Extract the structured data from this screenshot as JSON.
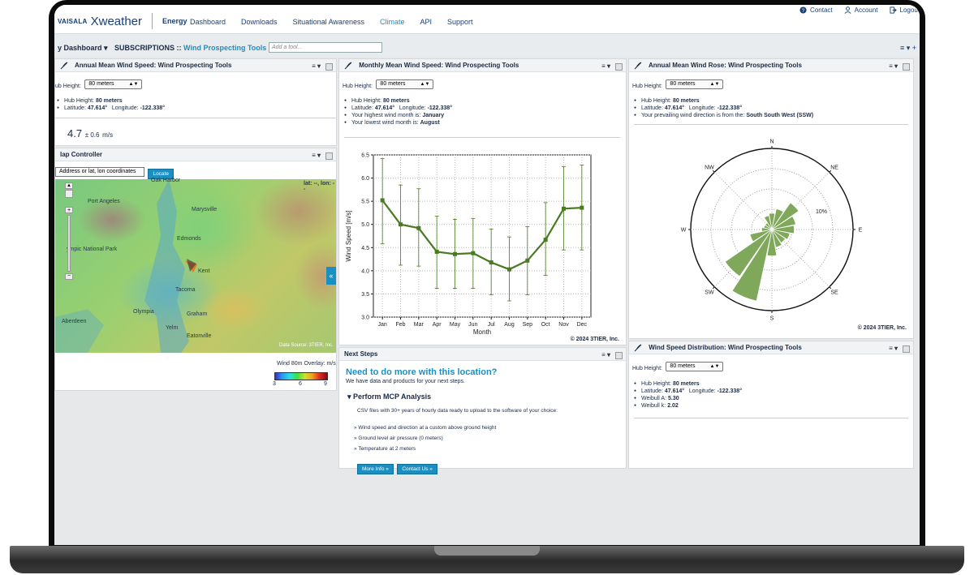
{
  "header": {
    "brand_small": "VAISALA",
    "brand_main": "Xweather",
    "product": "Energy",
    "nav": [
      "Dashboard",
      "Downloads",
      "Situational Awareness",
      "Climate",
      "API",
      "Support"
    ],
    "nav_active": "Climate",
    "util": {
      "contact": "Contact",
      "account": "Account",
      "logout": "Logout"
    }
  },
  "tabbar": {
    "dashboard": "y Dashboard ▾",
    "subs_prefix": "SUBSCRIPTIONS ::",
    "subs_name": "Wind Prospecting Tools",
    "addtool_placeholder": "Add a tool...",
    "rtools": "≡ ▾  +"
  },
  "panel_annual": {
    "title": "Annual Mean Wind Speed: Wind Prospecting Tools",
    "hub_label": "ub Height:",
    "hub_value": "80 meters",
    "info": [
      {
        "k": "Hub Height:",
        "v": "80 meters"
      },
      {
        "k": "Latitude:",
        "v": "47.614°",
        "k2": "Longitude:",
        "v2": "-122.338°"
      }
    ],
    "value": "4.7",
    "pm": "± 0.6",
    "unit": "m/s"
  },
  "panel_map": {
    "title": "lap Controller",
    "input_placeholder": "Address or lat, lon coordinates",
    "locate": "Locate",
    "coords": "lat: --, lon: --",
    "labels": [
      "Oak Harbor",
      "Port Angeles",
      "Marysville",
      "Edmonds",
      "ympic National Park",
      "Kent",
      "Tacoma",
      "Olympia",
      "Graham",
      "Aberdeen",
      "Yelm",
      "Eatonville"
    ],
    "datasource": "Data Source: 3TIER, Inc.",
    "overlay": "Wind 80m Overlay: m/s",
    "scale": [
      "3",
      "6",
      "9"
    ]
  },
  "panel_monthly": {
    "title": "Monthly Mean Wind Speed: Wind Prospecting Tools",
    "hub_label": "Hub Height:",
    "hub_value": "80 meters",
    "info": [
      {
        "k": "Hub Height:",
        "v": "80 meters"
      },
      {
        "k": "Latitude:",
        "v": "47.614°",
        "k2": "Longitude:",
        "v2": "-122.338°"
      },
      {
        "k": "Your highest wind month is:",
        "v": "January"
      },
      {
        "k": "Your lowest wind month is:",
        "v": "August"
      }
    ],
    "copyright": "© 2024 3TIER, Inc."
  },
  "chart_data": {
    "type": "line",
    "categories": [
      "Jan",
      "Feb",
      "Mar",
      "Apr",
      "May",
      "Jun",
      "Jul",
      "Aug",
      "Sep",
      "Oct",
      "Nov",
      "Dec"
    ],
    "values": [
      5.52,
      5.0,
      4.92,
      4.41,
      4.36,
      4.38,
      4.18,
      4.03,
      4.22,
      4.67,
      5.34,
      5.36
    ],
    "error_low": [
      4.58,
      4.12,
      4.1,
      3.62,
      3.62,
      3.62,
      3.48,
      3.35,
      3.48,
      3.9,
      4.45,
      4.45
    ],
    "error_high": [
      6.42,
      5.85,
      5.77,
      5.18,
      5.11,
      5.13,
      4.9,
      4.73,
      4.95,
      5.47,
      6.25,
      6.28
    ],
    "xlabel": "Month",
    "ylabel": "Wind Speed [m/s]",
    "ylim": [
      3.0,
      6.5
    ],
    "yticks": [
      "3.0",
      "3.5",
      "4.0",
      "4.5",
      "5.0",
      "5.5",
      "6.0",
      "6.5"
    ],
    "grid": true,
    "color": "#4a7a22"
  },
  "panel_rose": {
    "title": "Annual Mean Wind Rose: Wind Prospecting Tools",
    "hub_label": "Hub Height:",
    "hub_value": "80 meters",
    "info": [
      {
        "k": "Hub Height:",
        "v": "80 meters"
      },
      {
        "k": "Latitude:",
        "v": "47.614°",
        "k2": "Longitude:",
        "v2": "-122.338°"
      },
      {
        "k": "Your prevailing wind direction is from the:",
        "v": "South South West (SSW)"
      }
    ],
    "directions": [
      "N",
      "NE",
      "E",
      "SE",
      "S",
      "SW",
      "W",
      "NW"
    ],
    "ring_label": "10%",
    "copyright": "© 2024 3TIER, Inc."
  },
  "rose_data": {
    "type": "rose",
    "sectors": [
      "N",
      "NNE",
      "NE",
      "ENE",
      "E",
      "ESE",
      "SE",
      "SSE",
      "S",
      "SSW",
      "SW",
      "WSW",
      "W",
      "WNW",
      "NW",
      "NNW"
    ],
    "percent": [
      4.0,
      5.2,
      8.0,
      6.0,
      5.5,
      4.5,
      4.0,
      4.5,
      6.5,
      18.0,
      14.0,
      5.5,
      2.5,
      2.0,
      2.0,
      3.5
    ],
    "ring_max": 20,
    "color": "#7fa85a"
  },
  "panel_dist": {
    "title": "Wind Speed Distribution: Wind Prospecting Tools",
    "hub_label": "Hub Height:",
    "hub_value": "80 meters",
    "info": [
      {
        "k": "Hub Height:",
        "v": "80 meters"
      },
      {
        "k": "Latitude:",
        "v": "47.614°",
        "k2": "Longitude:",
        "v2": "-122.338°"
      },
      {
        "k": "Weibull A:",
        "v": "5.30"
      },
      {
        "k": "Weibull k:",
        "v": "2.02"
      }
    ]
  },
  "panel_next": {
    "title": "Next Steps",
    "headline": "Need to do more with this location?",
    "sub": "We have data and products for your next steps.",
    "section": "Perform MCP Analysis",
    "desc": "CSV files with 30+ years of hourly data ready to upload to the software of your choice:",
    "bullets": [
      "Wind speed and direction at a custom above ground height",
      "Ground level air pressure (0 meters)",
      "Temperature at 2 meters"
    ],
    "btn_more": "More Info »",
    "btn_contact": "Contact Us »"
  }
}
